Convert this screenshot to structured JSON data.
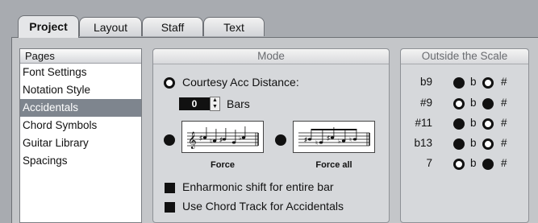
{
  "tabs": [
    {
      "label": "Project",
      "active": true
    },
    {
      "label": "Layout",
      "active": false
    },
    {
      "label": "Staff",
      "active": false
    },
    {
      "label": "Text",
      "active": false
    }
  ],
  "pages": {
    "header": "Pages",
    "items": [
      "Font Settings",
      "Notation Style",
      "Accidentals",
      "Chord Symbols",
      "Guitar Library",
      "Spacings"
    ],
    "selected": "Accidentals"
  },
  "mode": {
    "header": "Mode",
    "courtesy_label": "Courtesy Acc Distance:",
    "courtesy_selected": false,
    "bars_value": "0",
    "bars_label": "Bars",
    "force_label": "Force",
    "force_all_label": "Force all",
    "force_selected": true,
    "force_all_selected": true,
    "enharmonic_label": "Enharmonic shift for entire bar",
    "enharmonic_checked": true,
    "chord_track_label": "Use Chord Track for Accidentals",
    "chord_track_checked": true
  },
  "outside_scale": {
    "header": "Outside the Scale",
    "flat_symbol": "b",
    "sharp_symbol": "#",
    "rows": [
      {
        "name": "b9",
        "choice": "b"
      },
      {
        "name": "#9",
        "choice": "#"
      },
      {
        "name": "#11",
        "choice": "b"
      },
      {
        "name": "b13",
        "choice": "b"
      },
      {
        "name": "7",
        "choice": "#"
      }
    ]
  },
  "colors": {
    "selection": "#7e858e",
    "background": "#a8abb0",
    "panel": "#c4c6c9"
  }
}
